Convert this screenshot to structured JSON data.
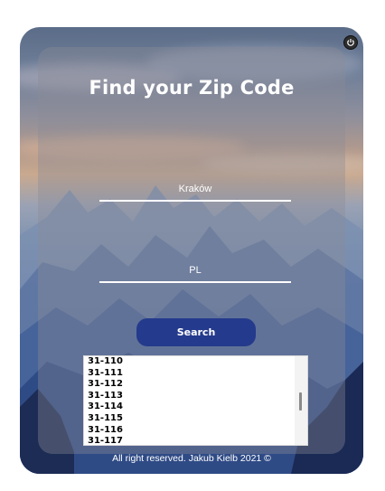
{
  "app": {
    "title": "Find your Zip Code"
  },
  "form": {
    "city_value": "Kraków",
    "country_value": "PL",
    "search_label": "Search"
  },
  "results": {
    "items": [
      "31-110",
      "31-111",
      "31-112",
      "31-113",
      "31-114",
      "31-115",
      "31-116",
      "31-117"
    ]
  },
  "footer": {
    "text": "All right reserved. Jakub Kielb 2021 ©"
  },
  "icons": {
    "power": "power-icon"
  },
  "colors": {
    "button": "#243a8c",
    "panel": "rgba(140,140,150,0.38)",
    "text": "#ffffff"
  }
}
